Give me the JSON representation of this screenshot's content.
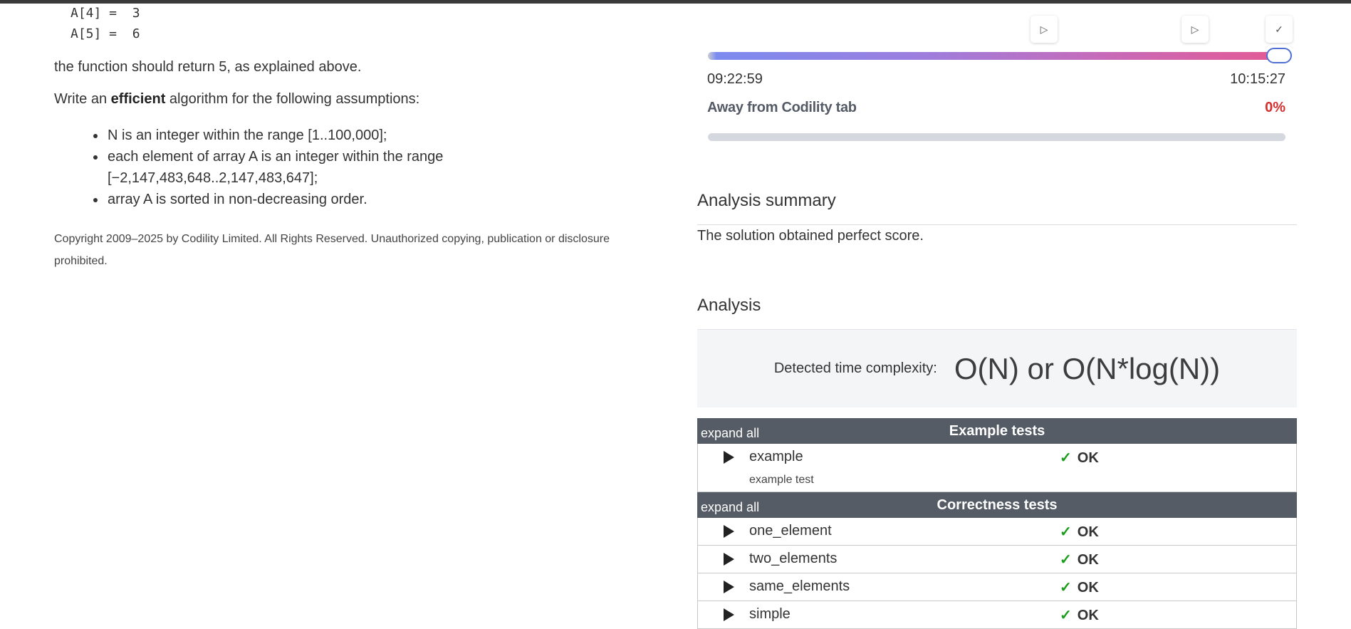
{
  "statement": {
    "code_lines": [
      "A[4] =  3",
      "A[5] =  6"
    ],
    "return_text": "the function should return 5, as explained above.",
    "write_prefix": "Write an ",
    "write_bold": "efficient",
    "write_suffix": " algorithm for the following assumptions:",
    "assumptions": [
      "N is an integer within the range [1..100,000];",
      "each element of array A is an integer within the range [−2,147,483,648..2,147,483,647];",
      "array A is sorted in non-decreasing order."
    ],
    "copyright": "Copyright 2009–2025 by Codility Limited. All Rights Reserved. Unauthorized copying, publication or disclosure prohibited."
  },
  "timeline": {
    "start_time": "09:22:59",
    "end_time": "10:15:27",
    "position_fraction": 1.0,
    "markers": [
      {
        "icon": "play-icon",
        "symbol": "▷"
      },
      {
        "icon": "play-icon",
        "symbol": "▷"
      },
      {
        "icon": "check-icon",
        "symbol": "✓"
      }
    ],
    "away_label": "Away from Codility tab",
    "away_value": "0%",
    "away_fraction": 0.0
  },
  "analysis_summary": {
    "heading": "Analysis summary",
    "text": "The solution obtained perfect score."
  },
  "analysis": {
    "heading": "Analysis",
    "complexity_label": "Detected time complexity:",
    "complexity_value": "O(N) or O(N*log(N))"
  },
  "test_groups": [
    {
      "expand_label": "expand all",
      "title": "Example tests",
      "tests": [
        {
          "name": "example",
          "description": "example test",
          "result": "OK"
        }
      ]
    },
    {
      "expand_label": "expand all",
      "title": "Correctness tests",
      "tests": [
        {
          "name": "one_element",
          "result": "OK"
        },
        {
          "name": "two_elements",
          "result": "OK"
        },
        {
          "name": "same_elements",
          "result": "OK"
        },
        {
          "name": "simple",
          "result": "OK"
        }
      ]
    }
  ],
  "colors": {
    "header_bg": "#555c65",
    "ok_check": "#1b9e1b",
    "away_value": "#d32f2f",
    "timeline_knob": "#4f6fd6"
  },
  "result_symbol": "✓"
}
